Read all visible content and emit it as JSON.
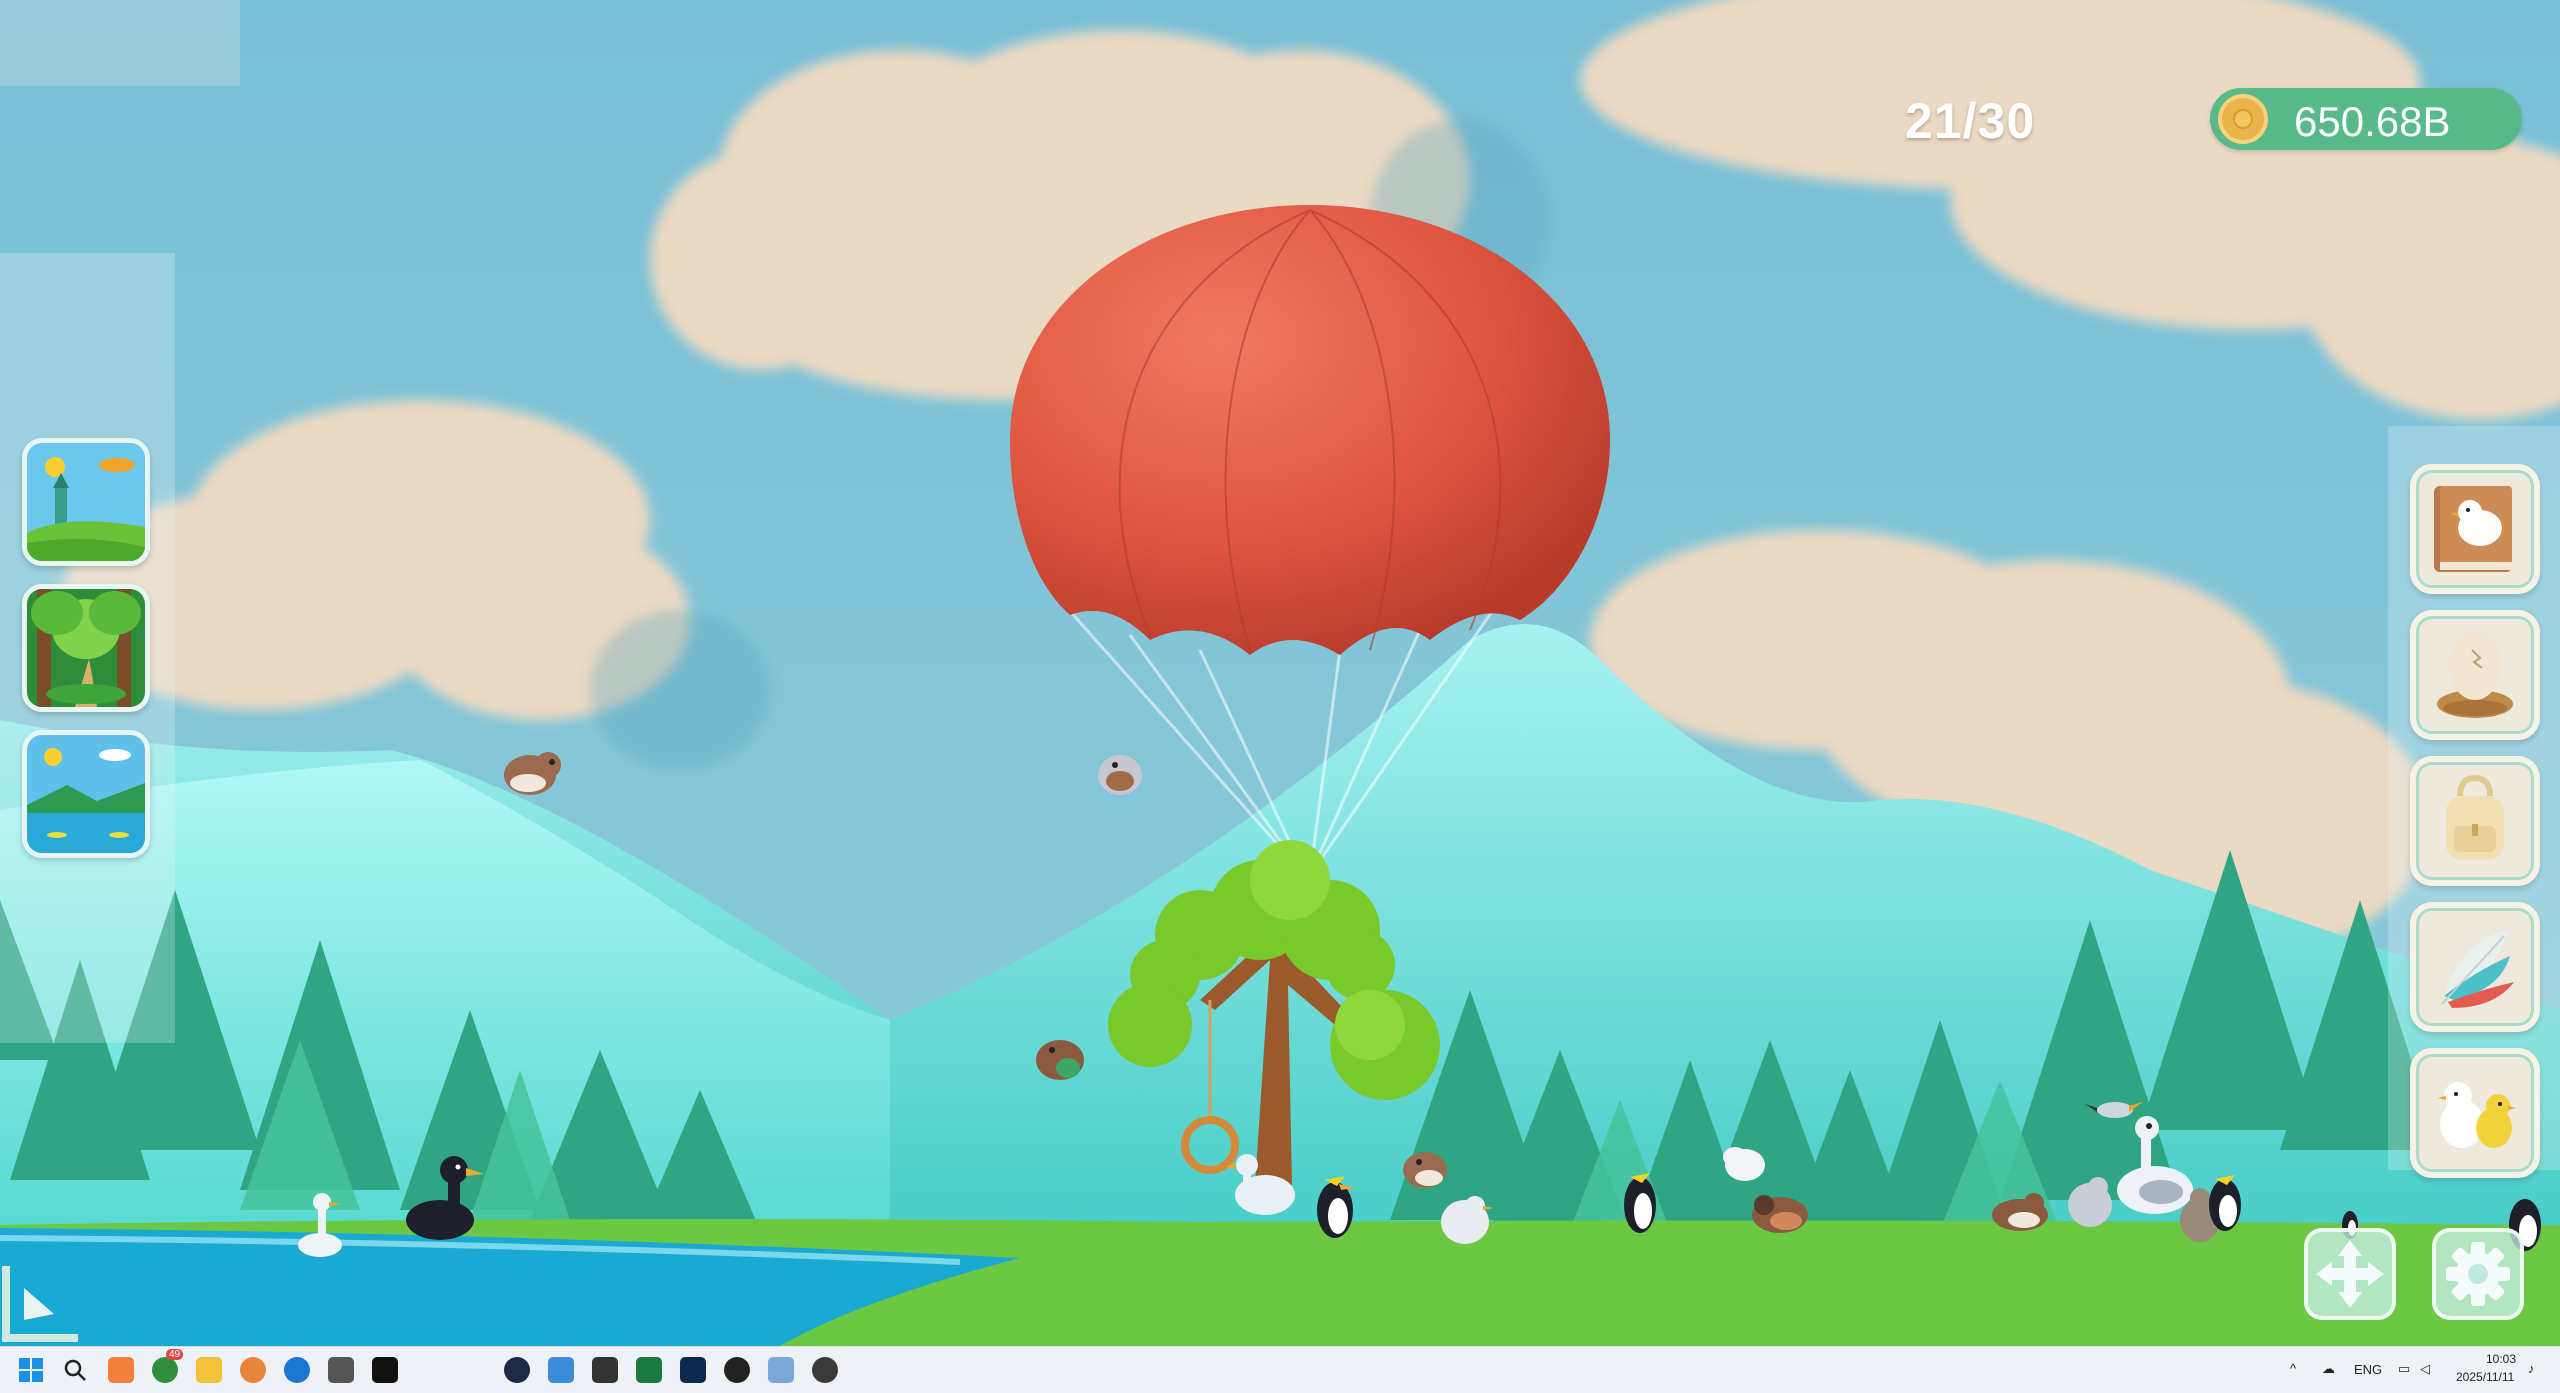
{
  "hud": {
    "bird_count": "21/30",
    "coins": "650.68B"
  },
  "scene_buttons": [
    {
      "name": "scene-castle-meadow",
      "icon": "castle-meadow-icon"
    },
    {
      "name": "scene-forest",
      "icon": "forest-icon"
    },
    {
      "name": "scene-lake",
      "icon": "lake-icon"
    }
  ],
  "side_buttons": [
    {
      "name": "bird-book-button",
      "icon": "bird-book-icon"
    },
    {
      "name": "egg-nest-button",
      "icon": "egg-nest-icon"
    },
    {
      "name": "backpack-button",
      "icon": "backpack-icon"
    },
    {
      "name": "feathers-button",
      "icon": "feathers-icon"
    },
    {
      "name": "bird-pair-button",
      "icon": "bird-pair-icon"
    }
  ],
  "taskbar": {
    "language": "ENG",
    "time": "10:03",
    "date": "2025/11/11",
    "browser_badge": "49"
  },
  "colors": {
    "sky": "#7fc2d8",
    "balloon": "#e05840",
    "grass": "#6cc842",
    "lake": "#1aa9d2",
    "coin_pill": "#58b98b"
  }
}
